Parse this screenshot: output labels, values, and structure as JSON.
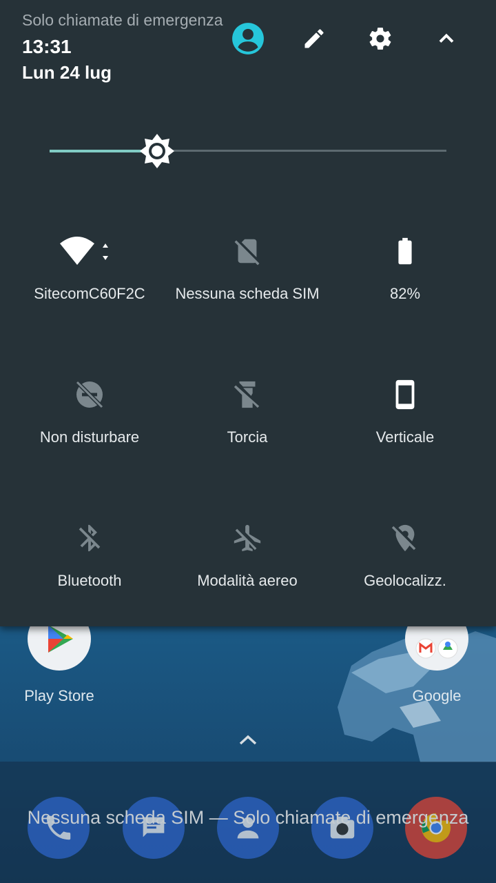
{
  "status": {
    "carrier_text": "Solo chiamate di emergenza",
    "time": "13:31",
    "date": "Lun 24 lug"
  },
  "header_icons": [
    "user-icon",
    "edit-icon",
    "settings-icon",
    "collapse-icon"
  ],
  "brightness": {
    "level": 0.27,
    "accent": "#80cbc4"
  },
  "tiles": [
    {
      "label": "SitecomC60F2C",
      "icon": "wifi-icon",
      "active": true
    },
    {
      "label": "Nessuna scheda SIM",
      "icon": "no-sim-icon",
      "active": false
    },
    {
      "label": "82%",
      "icon": "battery-icon",
      "active": true
    },
    {
      "label": "Non disturbare",
      "icon": "dnd-off-icon",
      "active": false
    },
    {
      "label": "Torcia",
      "icon": "flashlight-off-icon",
      "active": false
    },
    {
      "label": "Verticale",
      "icon": "portrait-icon",
      "active": true
    },
    {
      "label": "Bluetooth",
      "icon": "bluetooth-off-icon",
      "active": false
    },
    {
      "label": "Modalità aereo",
      "icon": "airplane-off-icon",
      "active": false
    },
    {
      "label": "Geolocalizz.",
      "icon": "location-off-icon",
      "active": false
    }
  ],
  "home": {
    "apps": [
      {
        "label": "Play Store",
        "icon": "play-store-icon"
      },
      {
        "label": "Google",
        "icon": "google-folder-icon"
      }
    ],
    "dock": [
      "phone-icon",
      "messages-icon",
      "contacts-icon",
      "camera-icon",
      "chrome-icon"
    ],
    "lockscreen_text": "Nessuna scheda SIM — Solo chiamate di emergenza"
  },
  "colors": {
    "shade_bg": "#263238",
    "active_icon": "#ffffff",
    "inactive_icon": "#7b878d"
  }
}
